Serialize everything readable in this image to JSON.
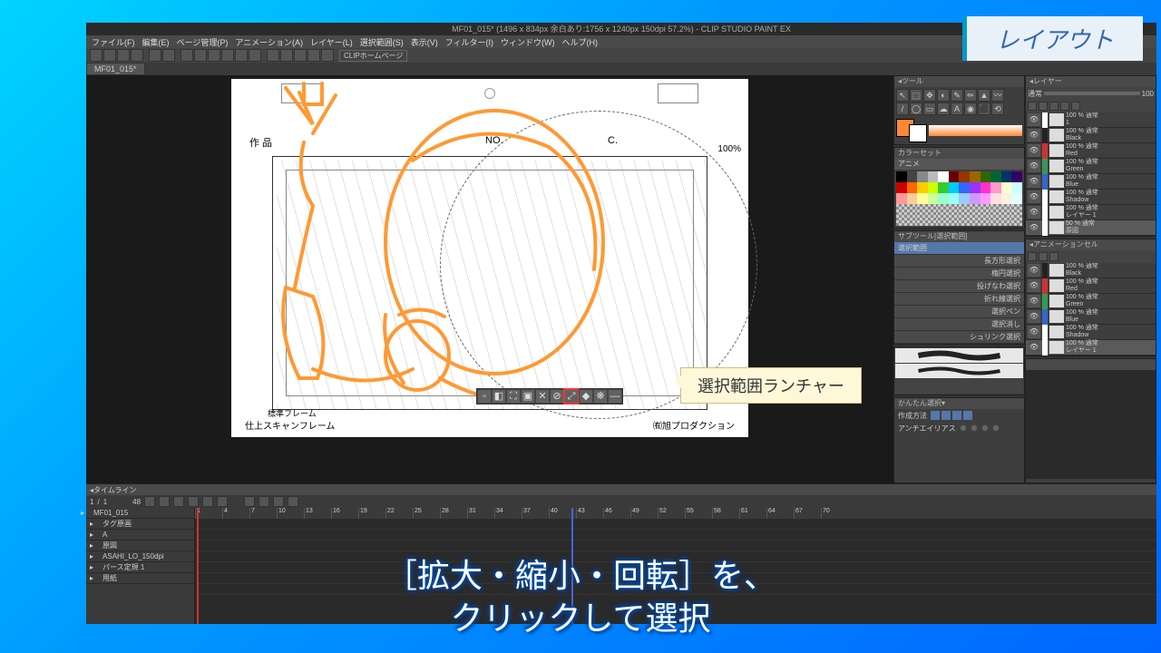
{
  "badge": "レイアウト",
  "callout": "選択範囲ランチャー",
  "subtitle_line1": "［拡大・縮小・回転］を、",
  "subtitle_line2": "クリックして選択",
  "titlebar": "MF01_015* (1496 x 834px 余白あり:1756 x 1240px 150dpi 57.2%) - CLIP STUDIO PAINT EX",
  "menu": [
    "ファイル(F)",
    "編集(E)",
    "ページ管理(P)",
    "アニメーション(A)",
    "レイヤー(L)",
    "選択範囲(S)",
    "表示(V)",
    "フィルター(I)",
    "ウィンドウ(W)",
    "ヘルプ(H)"
  ],
  "homepage_btn": "CLIPホームページ",
  "tab": "MF01_015*",
  "canvas": {
    "sakuhin": "作 品",
    "no": "NO.",
    "c": "C.",
    "zoom": "100%",
    "stdframe": "標準フレーム",
    "scanframe": "仕上スキャンフレーム",
    "company": "㈲旭プロダクション"
  },
  "panels": {
    "tool": "ツール",
    "colorset": "カラーセット",
    "anime": "アニメ",
    "subtool": "サブツール[選択範囲]",
    "subtool_tab": "選択範囲",
    "subtools": [
      "長方形選択",
      "楕円選択",
      "投げなわ選択",
      "折れ線選択",
      "選択ペン",
      "選択消し",
      "シュリンク選択"
    ],
    "quicksel": "かんたん選択",
    "method": "作成方法",
    "antialias": "アンチエイリアス",
    "layer": "レイヤー",
    "blend": "通常",
    "opacity": "100",
    "animcel": "アニメーションセル"
  },
  "layers1": [
    {
      "name": "1",
      "mode": "100 % 通常",
      "c": "#fff"
    },
    {
      "name": "Black",
      "mode": "100 % 通常",
      "c": "#222"
    },
    {
      "name": "Red",
      "mode": "100 % 通常",
      "c": "#cc3333"
    },
    {
      "name": "Green",
      "mode": "100 % 通常",
      "c": "#339955"
    },
    {
      "name": "Blue",
      "mode": "100 % 通常",
      "c": "#3366cc"
    },
    {
      "name": "Shadow",
      "mode": "100 % 通常",
      "c": "#fff"
    },
    {
      "name": "レイヤー 1",
      "mode": "100 % 通常",
      "c": "#fff"
    },
    {
      "name": "原図",
      "mode": "50 % 通常",
      "c": "#fff"
    }
  ],
  "layers2": [
    {
      "name": "Black",
      "mode": "100 % 通常",
      "c": "#222"
    },
    {
      "name": "Red",
      "mode": "100 % 通常",
      "c": "#cc3333"
    },
    {
      "name": "Green",
      "mode": "100 % 通常",
      "c": "#339955"
    },
    {
      "name": "Blue",
      "mode": "100 % 通常",
      "c": "#3366cc"
    },
    {
      "name": "Shadow",
      "mode": "100 % 通常",
      "c": "#fff"
    },
    {
      "name": "レイヤー 1",
      "mode": "100 % 通常",
      "c": "#fff"
    }
  ],
  "timeline": {
    "header": "タイムライン",
    "fps": "48",
    "clip": "MF01_015",
    "tracks": [
      "タグ原画",
      "A",
      "原図",
      "ASAHI_LO_150dpi",
      "パース定規 1",
      "用紙"
    ],
    "frames": [
      "1",
      "4",
      "7",
      "10",
      "13",
      "16",
      "19",
      "22",
      "25",
      "28",
      "31",
      "34",
      "37",
      "40",
      "43",
      "46",
      "49",
      "52",
      "55",
      "58",
      "61",
      "64",
      "67",
      "70"
    ]
  },
  "swatch_rows": [
    [
      "#000",
      "#444",
      "#888",
      "#bbb",
      "#fff",
      "#660000",
      "#993300",
      "#996600",
      "#336600",
      "#006633",
      "#003366",
      "#330066"
    ],
    [
      "#cc0000",
      "#ff6600",
      "#ffcc00",
      "#ccff00",
      "#33cc33",
      "#00ccff",
      "#3366ff",
      "#9933ff",
      "#ff33cc",
      "#ff99cc",
      "#ffffcc",
      "#ccffff"
    ],
    [
      "#ff9999",
      "#ffcc99",
      "#ffff99",
      "#ccff99",
      "#99ffcc",
      "#99ffff",
      "#99ccff",
      "#cc99ff",
      "#ff99ff",
      "#ffe0e0",
      "#fff0e0",
      "#e0ffff"
    ]
  ]
}
